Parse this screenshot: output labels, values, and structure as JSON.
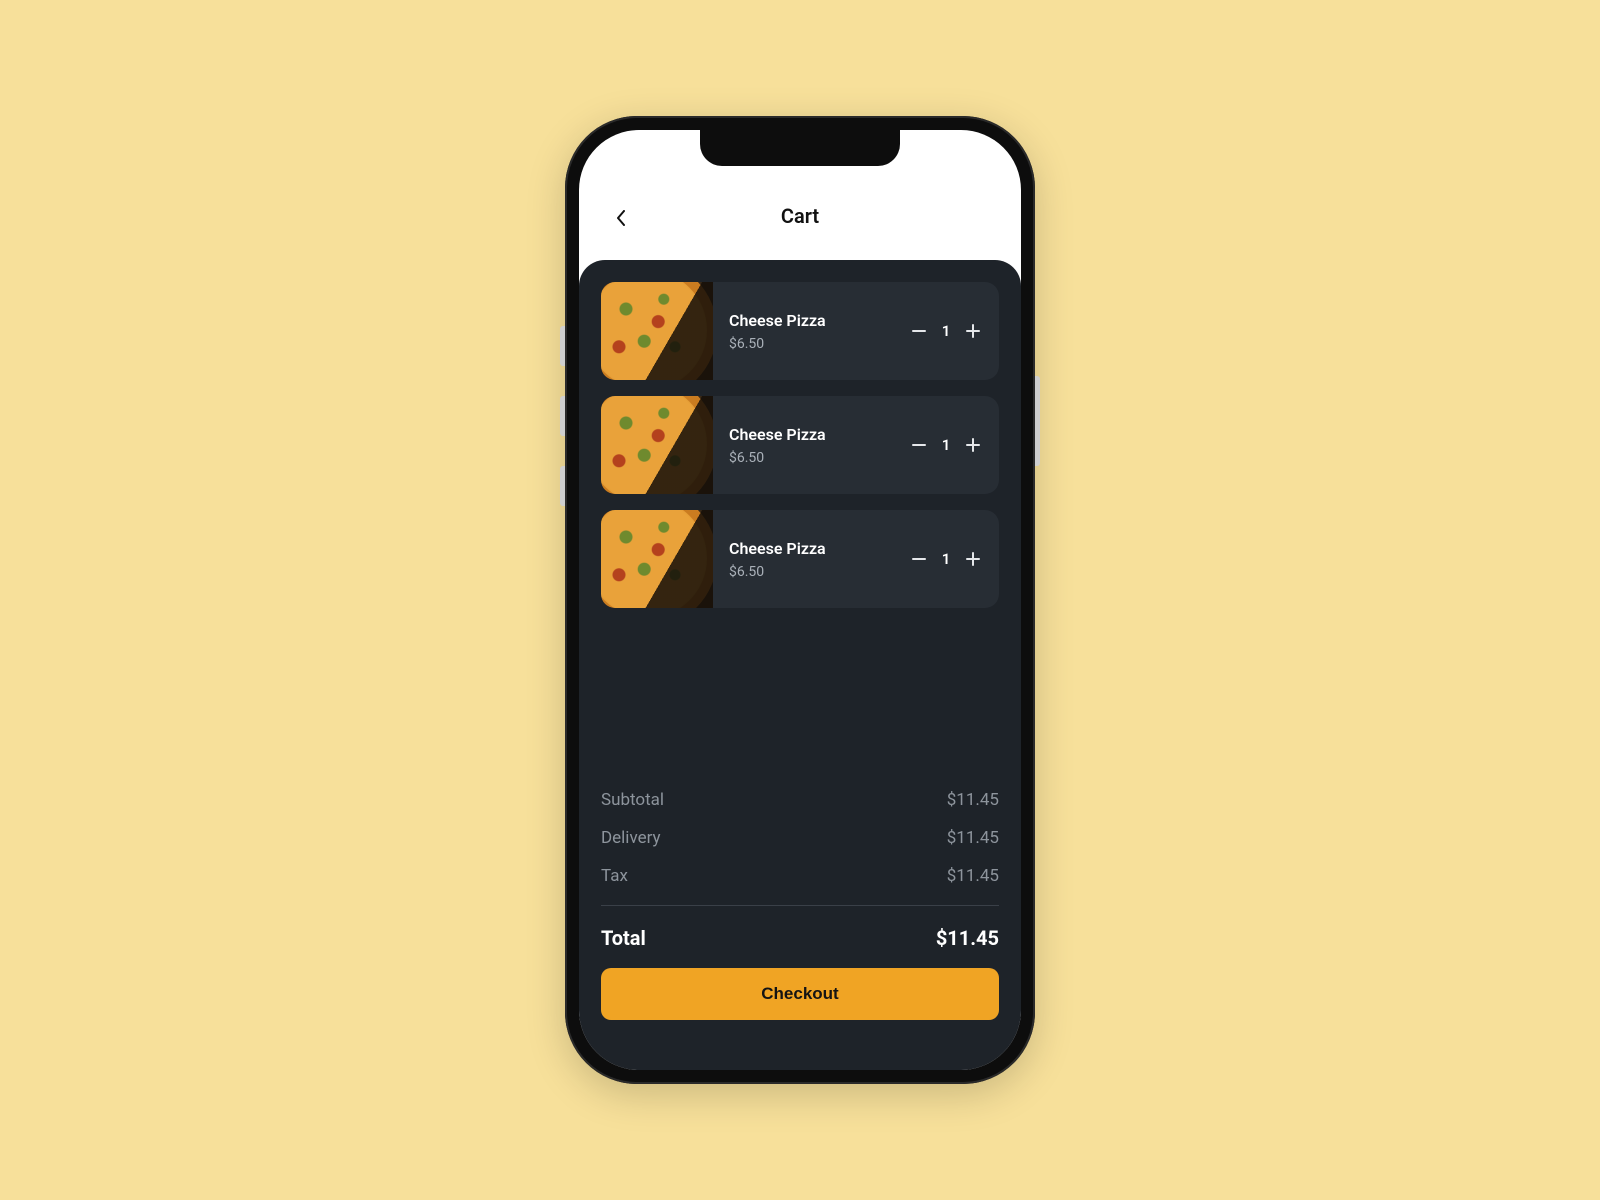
{
  "header": {
    "title": "Cart"
  },
  "cart": {
    "items": [
      {
        "name": "Cheese Pizza",
        "price": "$6.50",
        "qty": "1"
      },
      {
        "name": "Cheese Pizza",
        "price": "$6.50",
        "qty": "1"
      },
      {
        "name": "Cheese Pizza",
        "price": "$6.50",
        "qty": "1"
      }
    ]
  },
  "summary": {
    "subtotal_label": "Subtotal",
    "subtotal_value": "$11.45",
    "delivery_label": "Delivery",
    "delivery_value": "$11.45",
    "tax_label": "Tax",
    "tax_value": "$11.45",
    "total_label": "Total",
    "total_value": "$11.45"
  },
  "actions": {
    "checkout_label": "Checkout"
  }
}
